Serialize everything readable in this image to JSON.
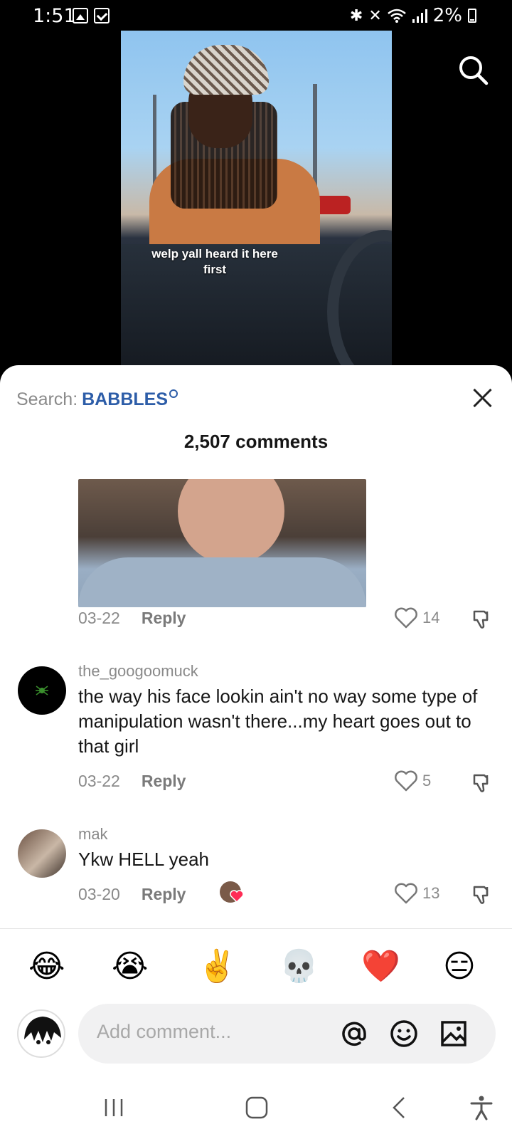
{
  "status_bar": {
    "time": "1:51",
    "battery": "2%"
  },
  "video": {
    "caption": "welp yall heard it here first"
  },
  "sheet": {
    "search_label": "Search:",
    "search_term": "BABBLES",
    "comment_count": "2,507 comments"
  },
  "comments": [
    {
      "date": "03-22",
      "reply": "Reply",
      "likes": "14"
    },
    {
      "username": "the_googoomuck",
      "text": "the way his face lookin ain't no way some type of manipulation wasn't there...my heart goes out to that girl",
      "date": "03-22",
      "reply": "Reply",
      "likes": "5"
    },
    {
      "username": "mak",
      "text": "Ykw HELL yeah",
      "date": "03-20",
      "reply": "Reply",
      "likes": "13"
    }
  ],
  "emojis": [
    "😂",
    "😭",
    "✌️",
    "💀",
    "❤️",
    "😑"
  ],
  "input": {
    "placeholder": "Add comment..."
  },
  "colors": {
    "accent": "#2d5da8",
    "sheet_bg": "#ffffff",
    "input_bg": "#f1f1f2"
  },
  "icons": [
    "search-icon",
    "close-icon",
    "heart-icon",
    "dislike-icon",
    "mention-icon",
    "emoji-icon",
    "image-icon",
    "recents-icon",
    "home-icon",
    "back-icon",
    "accessibility-icon"
  ]
}
